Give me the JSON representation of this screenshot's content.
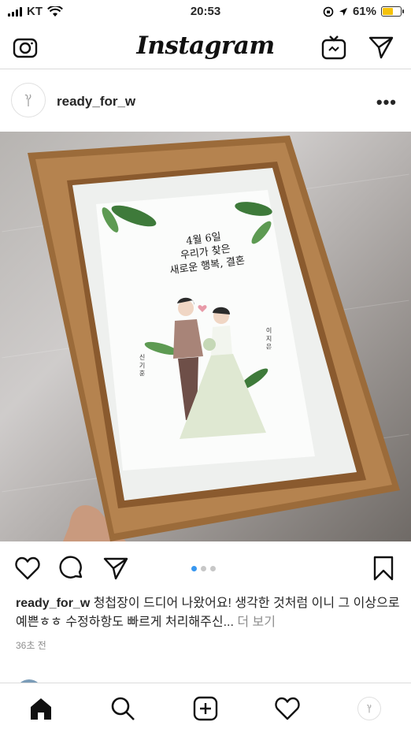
{
  "status_bar": {
    "carrier": "KT",
    "time": "20:53",
    "battery_percent": "61%",
    "battery_level": 0.61,
    "battery_color": "#f5c20b"
  },
  "header": {
    "logo_text": "Instagram",
    "icons": [
      "camera-icon",
      "igtv-icon",
      "direct-message-icon"
    ]
  },
  "post": {
    "username": "ready_for_w",
    "more_label": "•••",
    "carousel": {
      "count": 3,
      "active_index": 0,
      "active_color": "#3897f0"
    },
    "artwork": {
      "line1": "4월 6일",
      "line2": "우리가 찾은",
      "line3": "새로운 행복, 결혼",
      "groom_name": "신 기 훈",
      "bride_name": "이 지 은"
    },
    "caption": {
      "username": "ready_for_w",
      "text": " 청첩장이 드디어 나왔어요! 생각한 것처럼 이니 그 이상으로 예쁜ㅎㅎ 수정하항도 빠르게 처리해주신...",
      "more_label": " 더 보기"
    },
    "timestamp": "36초 전"
  },
  "bottom_nav": {
    "items": [
      "home-icon",
      "search-icon",
      "new-post-icon",
      "activity-heart-icon",
      "profile-avatar"
    ]
  }
}
